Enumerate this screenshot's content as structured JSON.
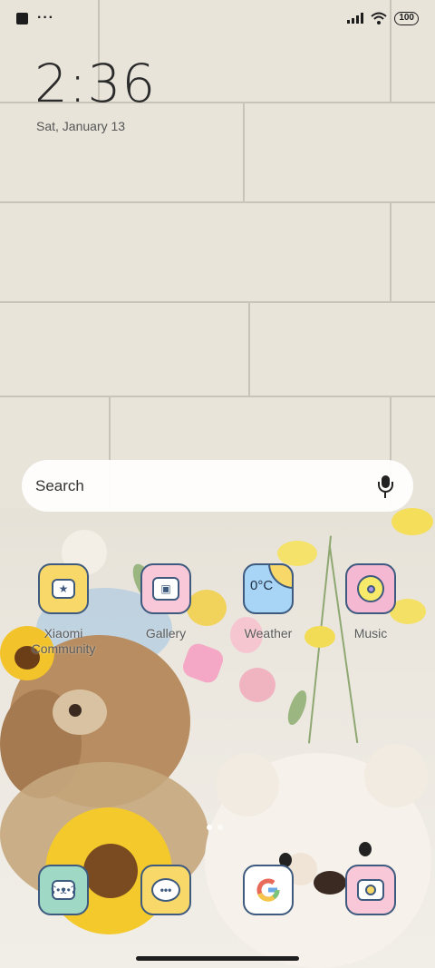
{
  "status_bar": {
    "notification_icons": [
      "app-notification-icon",
      "more-dots-icon"
    ],
    "more_indicator": "···",
    "battery": "100",
    "signal_icon": "signal-bars-icon",
    "wifi_icon": "wifi-icon"
  },
  "clock": {
    "time": "2:36",
    "date": "Sat, January 13"
  },
  "search": {
    "label": "Search",
    "mic_icon": "microphone-icon"
  },
  "apps_row": [
    {
      "label_line1": "Xiaomi",
      "label_line2": "Community",
      "icon": "bear-badge-icon",
      "color": "#f9d86a"
    },
    {
      "label": "Gallery",
      "icon": "gallery-photo-icon",
      "color": "#f8c8d8"
    },
    {
      "label": "Weather",
      "icon_text": "0°C",
      "icon": "weather-sun-icon",
      "color": "#a8d4f6"
    },
    {
      "label": "Music",
      "icon": "music-disc-icon",
      "color": "#f5b8d2"
    }
  ],
  "dock": [
    {
      "name": "phone",
      "icon": "bear-phone-icon",
      "color": "#9fd8c5"
    },
    {
      "name": "messages",
      "icon": "message-bubble-icon",
      "color": "#f9d86a"
    },
    {
      "name": "google",
      "icon": "google-g-icon",
      "color": "#ffffff"
    },
    {
      "name": "camera",
      "icon": "camera-icon",
      "color": "#f8c8d8"
    }
  ],
  "page_indicator": {
    "count": 2,
    "active": 0
  }
}
